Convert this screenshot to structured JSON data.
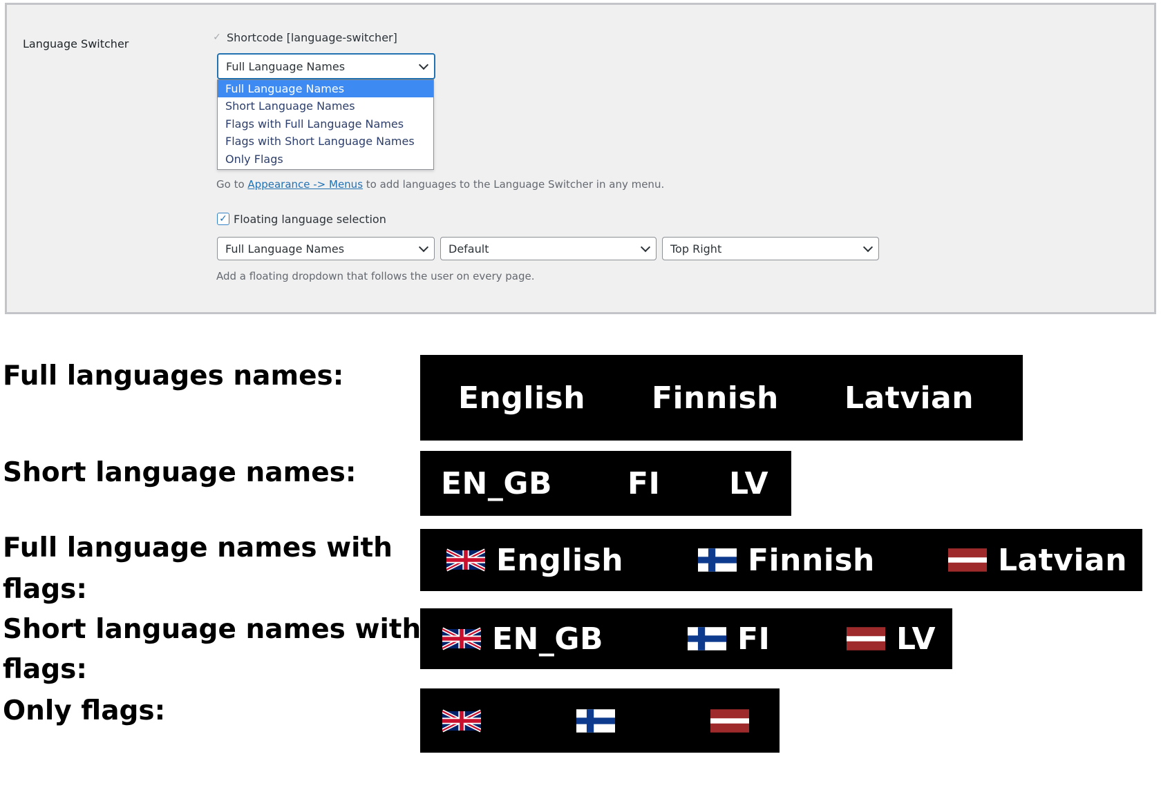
{
  "settings": {
    "row_label": "Language Switcher",
    "shortcode_label": "Shortcode [language-switcher]",
    "format_select_value": "Full Language Names",
    "format_options": [
      "Full Language Names",
      "Short Language Names",
      "Flags with Full Language Names",
      "Flags with Short Language Names",
      "Only Flags"
    ],
    "menu_hint": {
      "prefix": "Go to",
      "link": "Appearance -> Menus",
      "suffix": "to add languages to the Language Switcher in any menu."
    },
    "floating_label": "Floating language selection",
    "floating_selects": [
      "Full Language Names",
      "Default",
      "Top Right"
    ],
    "floating_hint": "Add a floating dropdown that follows the user on every page."
  },
  "examples": {
    "full_label": "Full languages names:",
    "short_label": "Short language names:",
    "full_flags_label_1": "Full language names with",
    "full_flags_label_2": "flags:",
    "short_flags_label_1": "Short language names with",
    "short_flags_label_2": "flags:",
    "only_flags_label": "Only flags:",
    "full_names": [
      "English",
      "Finnish",
      "Latvian"
    ],
    "short_names": [
      "EN_GB",
      "FI",
      "LV"
    ],
    "flags": [
      "uk-flag-icon",
      "finland-flag-icon",
      "latvia-flag-icon"
    ]
  },
  "colors": {
    "panel_bg": "#f0f0f1",
    "selected_option": "#3d8bf2",
    "link": "#2271b1",
    "bar_bg": "#000000"
  }
}
